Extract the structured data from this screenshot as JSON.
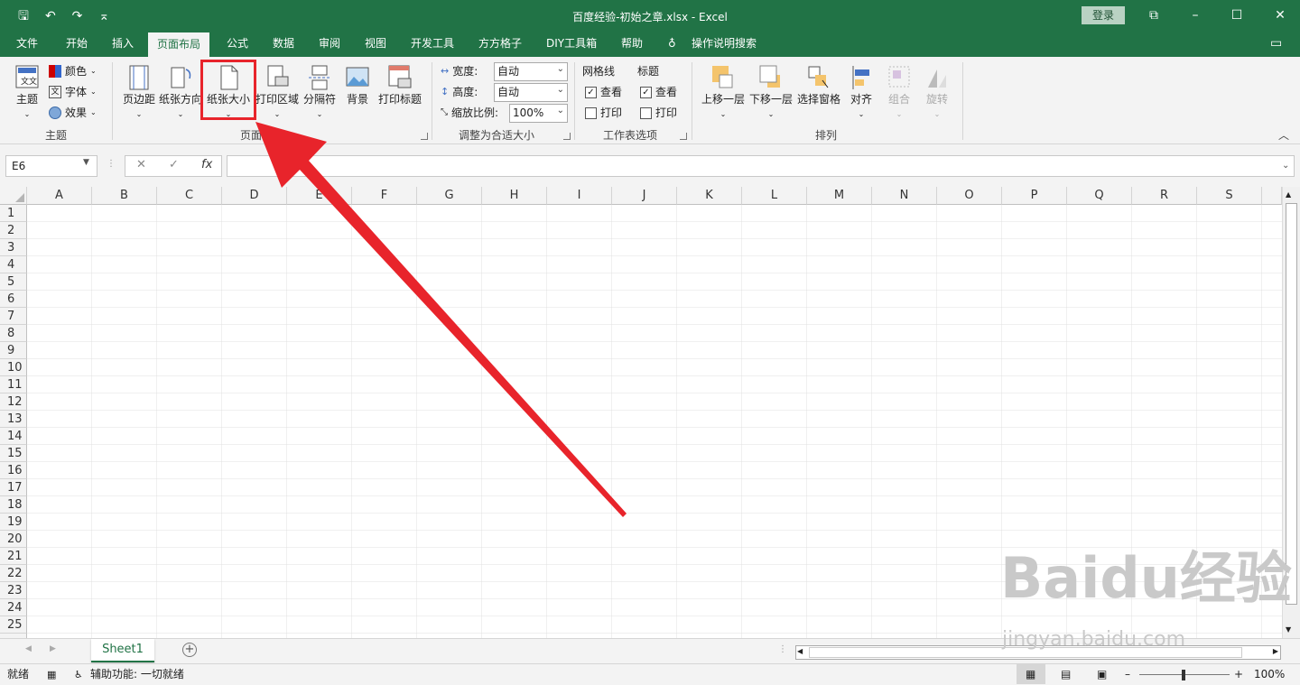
{
  "title_bar": {
    "title": "百度经验-初始之章.xlsx  -  Excel",
    "login": "登录",
    "save": "🖫",
    "undo": "↶",
    "redo": "↷",
    "customize": "⌅"
  },
  "menu": {
    "tabs": [
      "文件",
      "开始",
      "插入",
      "页面布局",
      "公式",
      "数据",
      "审阅",
      "视图",
      "开发工具",
      "方方格子",
      "DIY工具箱",
      "帮助"
    ],
    "active": "页面布局",
    "tell_me": "操作说明搜索"
  },
  "ribbon": {
    "themes": {
      "theme": "主题",
      "colors": "颜色",
      "fonts": "字体",
      "effects": "效果",
      "group": "主题"
    },
    "page_setup": {
      "margins": "页边距",
      "orientation": "纸张方向",
      "size": "纸张大小",
      "print_area": "打印区域",
      "breaks": "分隔符",
      "background": "背景",
      "print_titles": "打印标题",
      "group": "页面设置"
    },
    "scale": {
      "width_label": "宽度:",
      "width_value": "自动",
      "height_label": "高度:",
      "height_value": "自动",
      "scale_label": "缩放比例:",
      "scale_value": "100%",
      "group": "调整为合适大小"
    },
    "sheet_options": {
      "gridlines": "网格线",
      "headings": "标题",
      "view": "查看",
      "print": "打印",
      "group": "工作表选项"
    },
    "arrange": {
      "bring_forward": "上移一层",
      "send_backward": "下移一层",
      "selection_pane": "选择窗格",
      "align": "对齐",
      "group_btn": "组合",
      "rotate": "旋转",
      "group": "排列"
    }
  },
  "formula": {
    "name_box": "E6",
    "cancel": "✕",
    "enter": "✓",
    "fx": "fx",
    "value": ""
  },
  "grid": {
    "columns": [
      "A",
      "B",
      "C",
      "D",
      "E",
      "F",
      "G",
      "H",
      "I",
      "J",
      "K",
      "L",
      "M",
      "N",
      "O",
      "P",
      "Q",
      "R",
      "S"
    ],
    "rows": [
      "1",
      "2",
      "3",
      "4",
      "5",
      "6",
      "7",
      "8",
      "9",
      "10",
      "11",
      "12",
      "13",
      "14",
      "15",
      "16",
      "17",
      "18",
      "19",
      "20",
      "21",
      "22",
      "23",
      "24",
      "25"
    ]
  },
  "sheets": {
    "tabs": [
      "Sheet1"
    ],
    "add": "+"
  },
  "status": {
    "ready": "就绪",
    "accessibility": "辅助功能: 一切就绪",
    "zoom": "100%"
  },
  "watermark": {
    "brand": "Baidu经验",
    "url": "jingyan.baidu.com"
  },
  "colors": {
    "excel_green": "#217346",
    "highlight_red": "#e8242b"
  }
}
